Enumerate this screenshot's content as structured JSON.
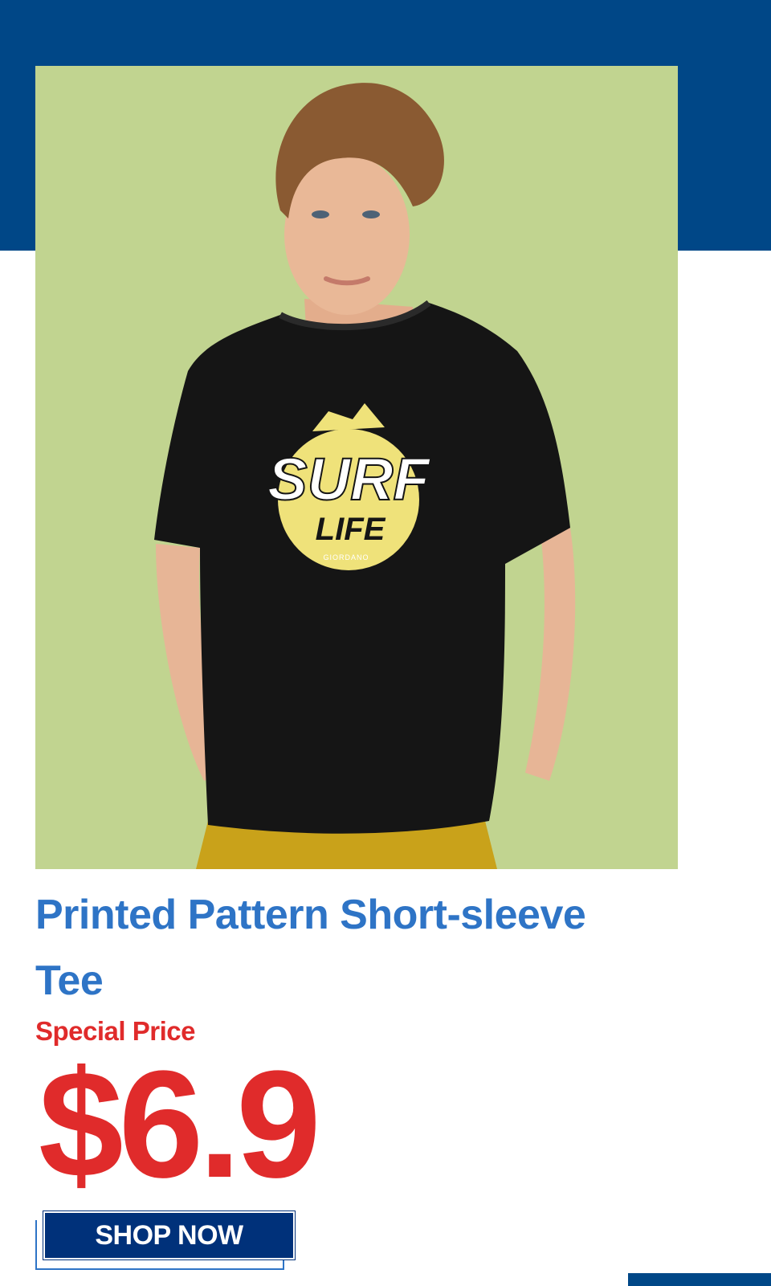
{
  "product": {
    "title_line1": "Printed Pattern Short-sleeve",
    "title_line2": "Tee",
    "special_label": "Special Price",
    "price": "$6.9",
    "cta_label": "SHOP NOW"
  },
  "image": {
    "alt": "Model wearing black SURF LIFE printed tee",
    "print_text_1": "SURF",
    "print_text_2": "LIFE",
    "brand_mark": "GIORDANO"
  },
  "colors": {
    "band_blue": "#004787",
    "title_blue": "#2e74c6",
    "price_red": "#e02b2b",
    "button_navy": "#00317a",
    "photo_bg": "#c1d490"
  }
}
